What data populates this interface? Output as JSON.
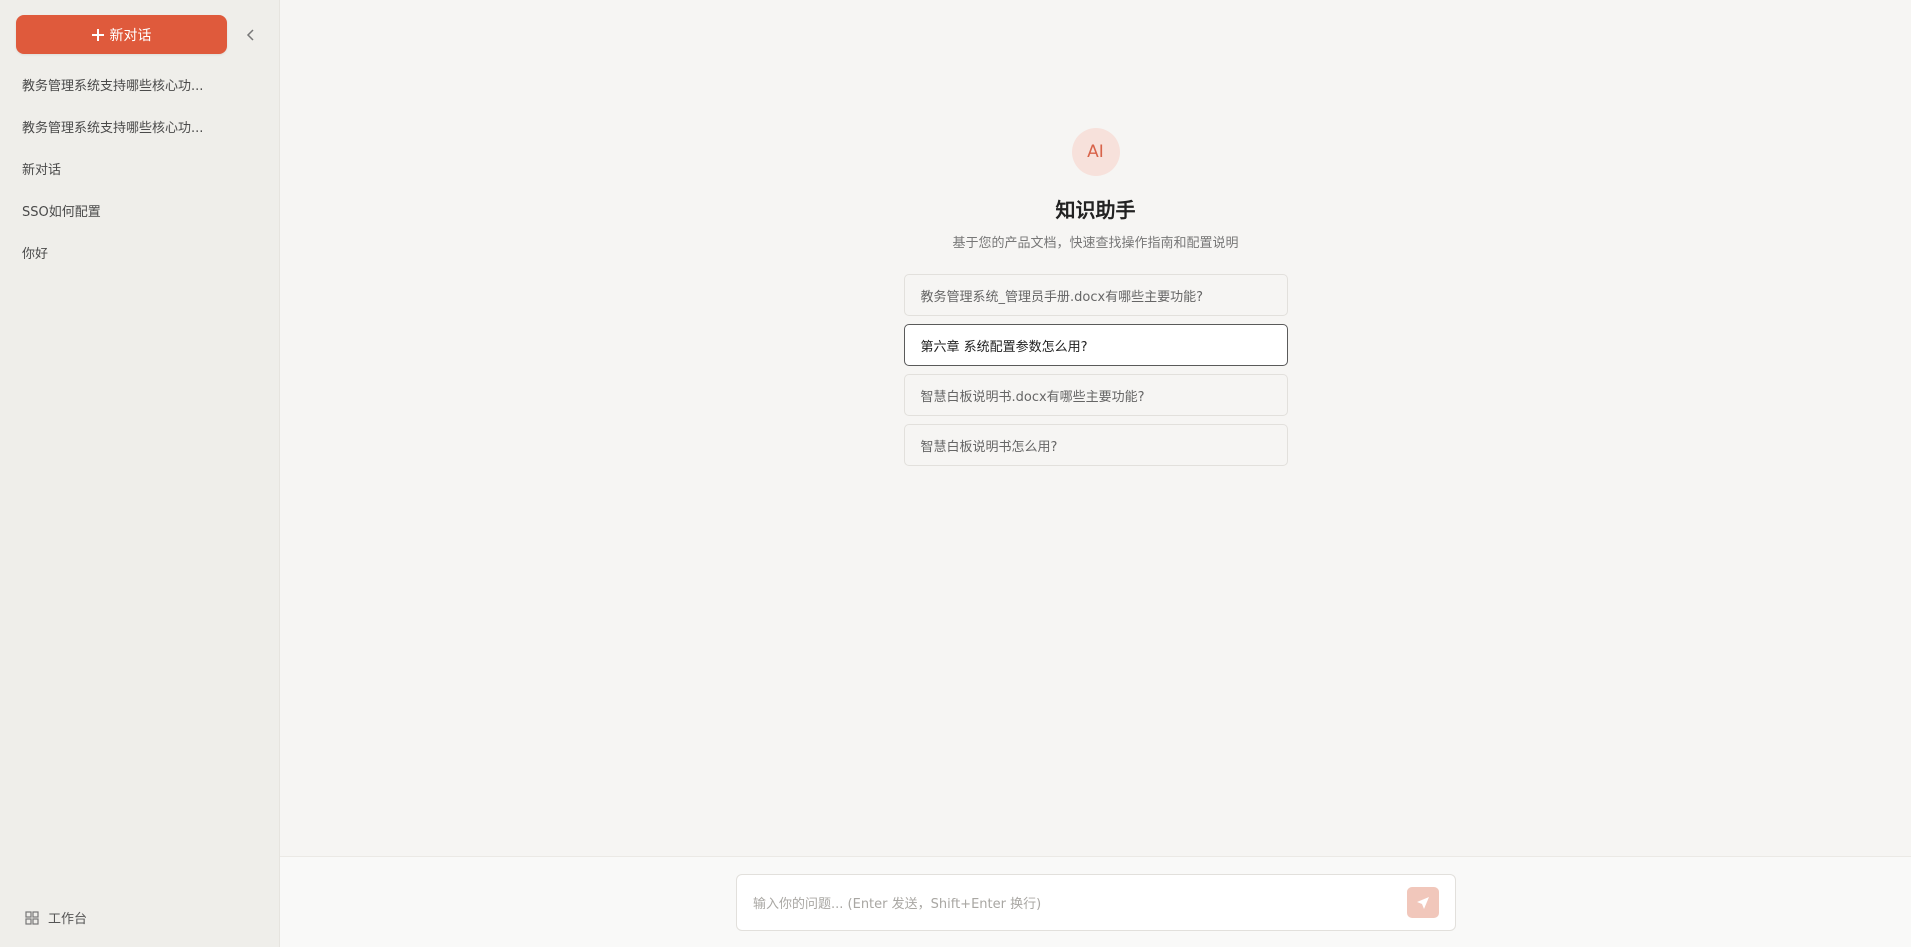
{
  "sidebar": {
    "new_chat_label": "新对话",
    "history": [
      "教务管理系统支持哪些核心功...",
      "教务管理系统支持哪些核心功...",
      "新对话",
      "SSO如何配置",
      "你好"
    ],
    "workbench_label": "工作台"
  },
  "main": {
    "avatar_text": "AI",
    "title": "知识助手",
    "subtitle": "基于您的产品文档，快速查找操作指南和配置说明",
    "suggestions": [
      "教务管理系统_管理员手册.docx有哪些主要功能?",
      "第六章 系统配置参数怎么用?",
      "智慧白板说明书.docx有哪些主要功能?",
      "智慧白板说明书怎么用?"
    ],
    "active_suggestion_index": 1
  },
  "composer": {
    "placeholder": "输入你的问题... (Enter 发送，Shift+Enter 换行)",
    "value": ""
  },
  "colors": {
    "accent": "#df5a3c",
    "send_disabled": "#f1c7bb",
    "avatar_bg": "#f7e1db"
  },
  "icons": {
    "new_chat": "plus-icon",
    "collapse": "chevron-left-icon",
    "workbench": "grid-icon",
    "send": "send-icon"
  }
}
